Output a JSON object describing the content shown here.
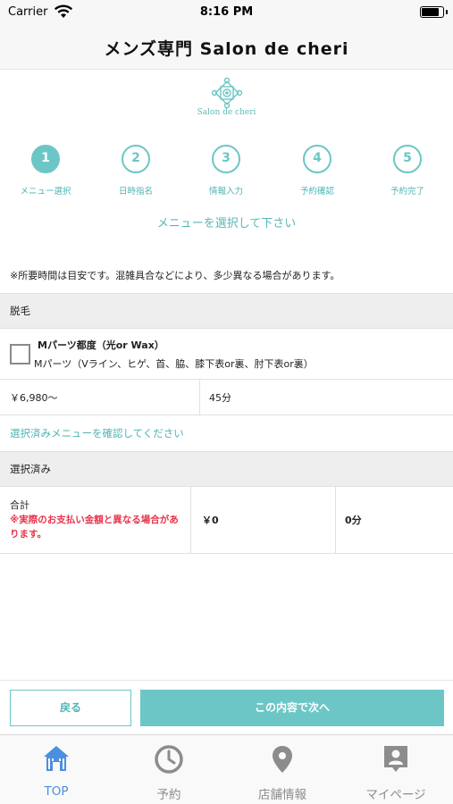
{
  "status_bar": {
    "carrier": "Carrier",
    "time": "8:16 PM",
    "battery_level": 0.85
  },
  "header": {
    "title": "メンズ専門 Salon de cheri"
  },
  "logo": {
    "text": "Salon de cheri"
  },
  "steps": [
    {
      "number": "1",
      "label": "メニュー選択",
      "active": true
    },
    {
      "number": "2",
      "label": "日時指名",
      "active": false
    },
    {
      "number": "3",
      "label": "情報入力",
      "active": false
    },
    {
      "number": "4",
      "label": "予約確認",
      "active": false
    },
    {
      "number": "5",
      "label": "予約完了",
      "active": false
    }
  ],
  "instruction": "メニューを選択して下さい",
  "notice": "※所要時間は目安です。混雑具合などにより、多少異なる場合があります。",
  "category": {
    "title": "脱毛"
  },
  "menu_item": {
    "name": "Mパーツ都度（光or Wax）",
    "description": "Mパーツ（Vライン、ヒゲ、首、脇、膝下表or裏、肘下表or裏）",
    "price": "￥6,980〜",
    "duration": "45分",
    "checked": false
  },
  "confirm_link": "選択済みメニューを確認してください",
  "selected": {
    "title": "選択済み",
    "total_label": "合計",
    "warning": "※実際のお支払い金額と異なる場合があります。",
    "total_price": "￥0",
    "total_time": "0分"
  },
  "actions": {
    "back": "戻る",
    "next": "この内容で次へ"
  },
  "tabs": [
    {
      "label": "TOP",
      "icon": "home-icon",
      "active": true
    },
    {
      "label": "予約",
      "icon": "clock-icon",
      "active": false
    },
    {
      "label": "店舗情報",
      "icon": "map-pin-icon",
      "active": false
    },
    {
      "label": "マイページ",
      "icon": "user-badge-icon",
      "active": false
    }
  ],
  "colors": {
    "accent": "#6cc6c6",
    "accent_text": "#4fb3b3",
    "warning": "#e8334a",
    "tab_active": "#4a8fe0",
    "tab_inactive": "#8c8c8c"
  }
}
